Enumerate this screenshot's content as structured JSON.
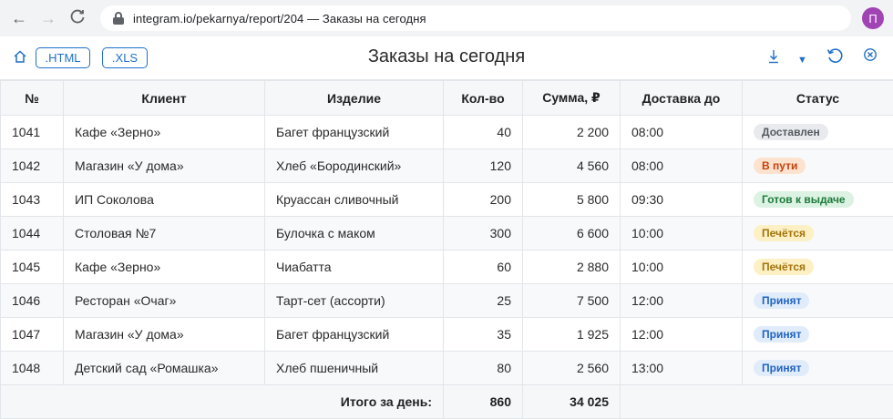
{
  "browser": {
    "url_host": "integram.io",
    "url_path": "/pekarnya/report/204",
    "tab_title": "Заказы на сегодня",
    "url_separator": " — ",
    "avatar_letter": "П"
  },
  "toolbar": {
    "home_icon": "home-icon",
    "export_html_label": ".HTML",
    "export_xls_label": ".XLS",
    "title": "Заказы на сегодня",
    "icons": [
      "download-icon",
      "chevron-down-icon",
      "history-icon",
      "close-circle-icon"
    ]
  },
  "table": {
    "columns": [
      "№",
      "Клиент",
      "Изделие",
      "Кол-во",
      "Сумма, ₽",
      "Доставка до",
      "Статус"
    ],
    "rows": [
      {
        "id": "1041",
        "client": "Кафе «Зерно»",
        "product": "Багет французский",
        "qty": "40",
        "sum": "2 200",
        "delivery": "08:00",
        "status": "Доставлен",
        "status_key": "delivered"
      },
      {
        "id": "1042",
        "client": "Магазин «У дома»",
        "product": "Хлеб «Бородинский»",
        "qty": "120",
        "sum": "4 560",
        "delivery": "08:00",
        "status": "В пути",
        "status_key": "transit"
      },
      {
        "id": "1043",
        "client": "ИП Соколова",
        "product": "Круассан сливочный",
        "qty": "200",
        "sum": "5 800",
        "delivery": "09:30",
        "status": "Готов к выдаче",
        "status_key": "ready"
      },
      {
        "id": "1044",
        "client": "Столовая №7",
        "product": "Булочка с маком",
        "qty": "300",
        "sum": "6 600",
        "delivery": "10:00",
        "status": "Печётся",
        "status_key": "baking"
      },
      {
        "id": "1045",
        "client": "Кафе «Зерно»",
        "product": "Чиабатта",
        "qty": "60",
        "sum": "2 880",
        "delivery": "10:00",
        "status": "Печётся",
        "status_key": "baking"
      },
      {
        "id": "1046",
        "client": "Ресторан «Очаг»",
        "product": "Тарт-сет (ассорти)",
        "qty": "25",
        "sum": "7 500",
        "delivery": "12:00",
        "status": "Принят",
        "status_key": "accepted"
      },
      {
        "id": "1047",
        "client": "Магазин «У дома»",
        "product": "Багет французский",
        "qty": "35",
        "sum": "1 925",
        "delivery": "12:00",
        "status": "Принят",
        "status_key": "accepted"
      },
      {
        "id": "1048",
        "client": "Детский сад «Ромашка»",
        "product": "Хлеб пшеничный",
        "qty": "80",
        "sum": "2 560",
        "delivery": "13:00",
        "status": "Принят",
        "status_key": "accepted"
      }
    ],
    "footer": {
      "label": "Итого за день:",
      "qty_total": "860",
      "sum_total": "34 025"
    }
  },
  "status_colors": {
    "delivered": {
      "bg": "#e8eaed",
      "fg": "#555a60"
    },
    "transit": {
      "bg": "#fde3cf",
      "fg": "#c2410c"
    },
    "ready": {
      "bg": "#dcf2e2",
      "fg": "#1e7a3c"
    },
    "baking": {
      "bg": "#fdf0c4",
      "fg": "#a4730a"
    },
    "accepted": {
      "bg": "#e1ecfb",
      "fg": "#1f63c2"
    }
  },
  "colors": {
    "accent": "#1f6fc9",
    "avatar": "#a142b5"
  }
}
